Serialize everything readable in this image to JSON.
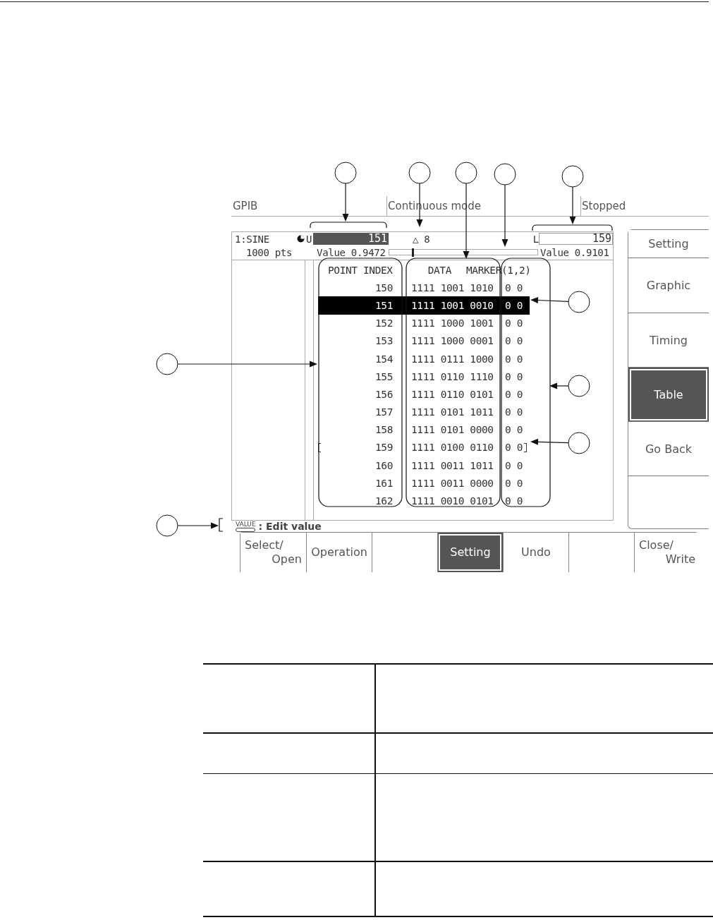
{
  "status_bar": [
    {
      "text": "GPIB"
    },
    {
      "text": "Continuous mode"
    },
    {
      "text": "Stopped"
    }
  ],
  "waveform": {
    "name": "1:SINE",
    "points": "1000 pts"
  },
  "upper_cursor": {
    "label": "U",
    "value": "151",
    "reading": "Value 0.9472"
  },
  "delta": "△ 8",
  "lower_cursor": {
    "label": "L",
    "value": "159",
    "reading": "Value 0.9101"
  },
  "table": {
    "columns": [
      "POINT INDEX",
      "DATA",
      "MARKER(1,2)"
    ],
    "rows": [
      {
        "cells": [
          "150",
          "1111 1001 1010",
          "0 0"
        ],
        "selected": false,
        "bracketed": false
      },
      {
        "cells": [
          "151",
          "1111 1001 0010",
          "0 0"
        ],
        "selected": true,
        "bracketed": false
      },
      {
        "cells": [
          "152",
          "1111 1000 1001",
          "0 0"
        ],
        "selected": false,
        "bracketed": false
      },
      {
        "cells": [
          "153",
          "1111 1000 0001",
          "0 0"
        ],
        "selected": false,
        "bracketed": false
      },
      {
        "cells": [
          "154",
          "1111 0111 1000",
          "0 0"
        ],
        "selected": false,
        "bracketed": false
      },
      {
        "cells": [
          "155",
          "1111 0110 1110",
          "0 0"
        ],
        "selected": false,
        "bracketed": false
      },
      {
        "cells": [
          "156",
          "1111 0110 0101",
          "0 0"
        ],
        "selected": false,
        "bracketed": false
      },
      {
        "cells": [
          "157",
          "1111 0101 1011",
          "0 0"
        ],
        "selected": false,
        "bracketed": false
      },
      {
        "cells": [
          "158",
          "1111 0101 0000",
          "0 0"
        ],
        "selected": false,
        "bracketed": false
      },
      {
        "cells": [
          "159",
          "1111 0100 0110",
          "0 0"
        ],
        "selected": false,
        "bracketed": true
      },
      {
        "cells": [
          "160",
          "1111 0011 1011",
          "0 0"
        ],
        "selected": false,
        "bracketed": false
      },
      {
        "cells": [
          "161",
          "1111 0011 0000",
          "0 0"
        ],
        "selected": false,
        "bracketed": false
      },
      {
        "cells": [
          "162",
          "1111 0010 0101",
          "0 0"
        ],
        "selected": false,
        "bracketed": false
      }
    ]
  },
  "side_menu": [
    {
      "label": "Setting",
      "selected": false
    },
    {
      "label": "Graphic",
      "selected": false
    },
    {
      "label": "Timing",
      "selected": false
    },
    {
      "label": "Table",
      "selected": true
    },
    {
      "label": "Go Back",
      "selected": false
    }
  ],
  "hint": {
    "key": "VALUE",
    "text": ": Edit value"
  },
  "bottom_buttons": [
    {
      "lines": [
        "Select/",
        "Open"
      ],
      "selected": false
    },
    {
      "lines": [
        "Operation"
      ],
      "selected": false
    },
    {
      "selected": false
    },
    {
      "lines": [
        "Setting"
      ],
      "selected": true
    },
    {
      "lines": [
        "Undo"
      ],
      "selected": false
    },
    {
      "selected": false
    },
    {
      "lines": [
        "Close/",
        "Write"
      ],
      "selected": false
    }
  ]
}
